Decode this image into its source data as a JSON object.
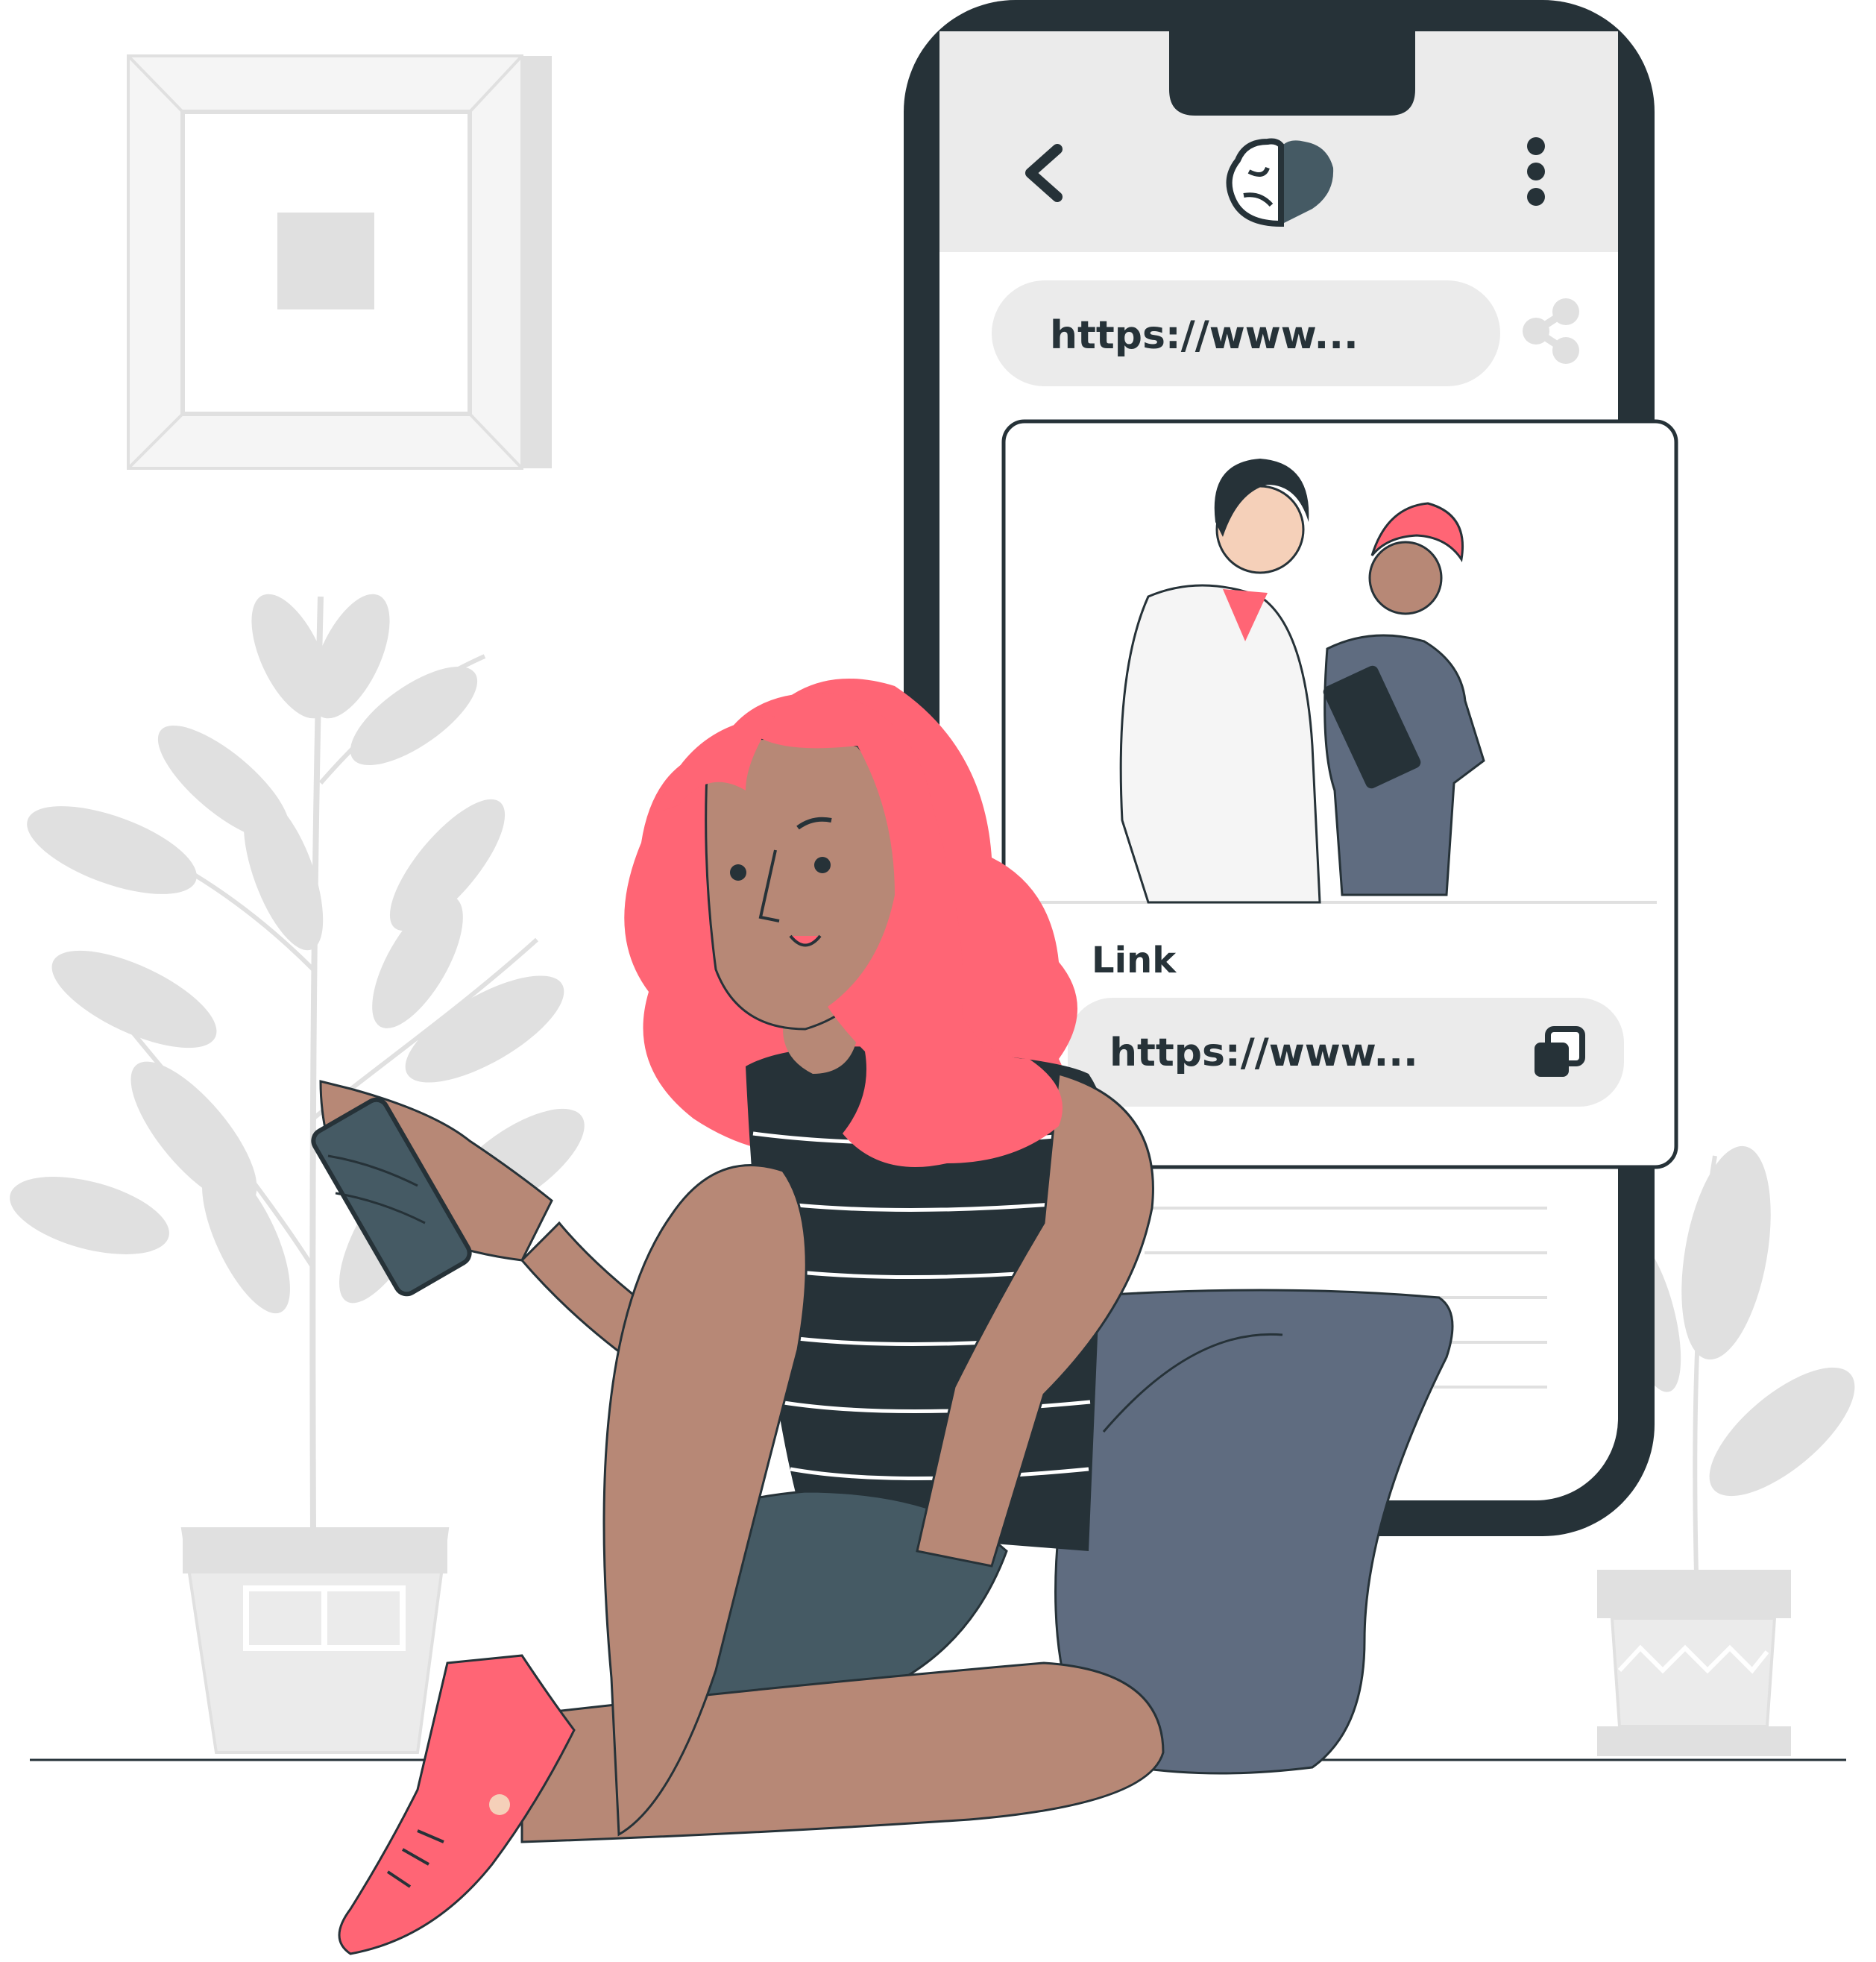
{
  "phone": {
    "header": {
      "back_icon": "chevron-left-icon",
      "logo_icon": "brain-heart-logo-icon",
      "menu_icon": "vertical-dots-icon"
    },
    "address_bar": {
      "url": "https://www..."
    },
    "share_icon": "share-icon",
    "link_card": {
      "label": "Link",
      "url": "https://www...",
      "copy_icon": "copy-icon"
    }
  },
  "colors": {
    "dark": "#263238",
    "accent": "#FF6575",
    "skin": "#B78876",
    "pillow": "#5F6C80",
    "light_gray": "#EBEBEB",
    "mid_gray": "#E0E0E0",
    "shorts": "#455A64"
  }
}
